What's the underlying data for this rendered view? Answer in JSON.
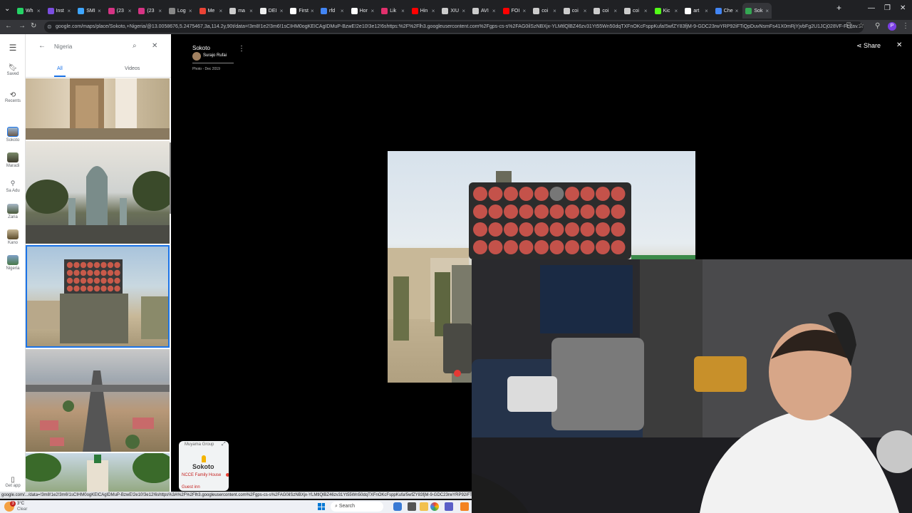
{
  "browser": {
    "tabs": [
      {
        "label": "Wh",
        "color": "#25D366"
      },
      {
        "label": "Inst",
        "color": "#7b4ee0"
      },
      {
        "label": "SMI",
        "color": "#3ea6ff"
      },
      {
        "label": "(23",
        "color": "#d63384"
      },
      {
        "label": "(23",
        "color": "#d63384"
      },
      {
        "label": "Log",
        "color": "#888"
      },
      {
        "label": "Me",
        "color": "#ea4335"
      },
      {
        "label": "ma",
        "color": "#ccc"
      },
      {
        "label": "DEI",
        "color": "#eee"
      },
      {
        "label": "First",
        "color": "#fff"
      },
      {
        "label": "rfd",
        "color": "#4285f4"
      },
      {
        "label": "Hor",
        "color": "#fff"
      },
      {
        "label": "Lik",
        "color": "#e1306c"
      },
      {
        "label": "Hin",
        "color": "#ff0000"
      },
      {
        "label": "XIU",
        "color": "#ccc"
      },
      {
        "label": "AVI",
        "color": "#ccc"
      },
      {
        "label": "FOI",
        "color": "#ff0000"
      },
      {
        "label": "coi",
        "color": "#ccc"
      },
      {
        "label": "coi",
        "color": "#ccc"
      },
      {
        "label": "coi",
        "color": "#ccc"
      },
      {
        "label": "coi",
        "color": "#ccc"
      },
      {
        "label": "Kic",
        "color": "#53fc18"
      },
      {
        "label": "art",
        "color": "#fff"
      },
      {
        "label": "Che",
        "color": "#4285f4"
      },
      {
        "label": "Sok",
        "color": "#34a853"
      }
    ],
    "close_glyph": "×",
    "new_tab": "+",
    "url": "google.com/maps/place/Sokoto,+Nigeria/@13.0058676,5.2475467,3a,114.2y,90t/data=!3m8!1e2!3m6!1sCIHM0ogKEICAgIDMuP-BzwE!2e10!3e12!6shttps:%2F%2Flh3.googleusercontent.com%2Fgps-cs-s%2FAG0ilSzNBXjx-YLMtlQlBZ46zv31Yt55Wn50dqTXFnOKcFsppKufa!5wfZY83fjM-9-GDC23rwYRP92iFTiQpDuvNsmFs41X0mRjYjvbFg2U1JCj028VF-FL2av...",
    "profile_initial": "P"
  },
  "rail": {
    "menu_icon": "menu-icon",
    "saved": "Saved",
    "recents": "Recents",
    "places": [
      "Sokoto",
      "Maradi",
      "Sa Adu",
      "Zaria",
      "Kano",
      "Nigeria"
    ],
    "get_app": "Get app"
  },
  "panel": {
    "search_value": "Nigeria",
    "tab_all": "All",
    "tab_videos": "Videos"
  },
  "viewer": {
    "place": "Sokoto",
    "author": "Surajo Rufai",
    "date": "Photo - Dec 2019",
    "share": "Share",
    "minimap": {
      "label_top": "Muyama Group",
      "city": "Sokoto",
      "poi": "NCCE Family House",
      "poi2": "Guest inn"
    }
  },
  "statusbar": {
    "text": "google.com/.../data=!3m8!1e2!3m6!1sCIHM0ogKEICAgIDMuP-BzwE!2e10!3e12!6shttps%3A%2F%2Flh3.googleusercontent.com%2Fgps-cs-s%2FAG0ilSzNBXjx-YLMtlQlBZ46zv31Yt55Wn50dqTXFnOKcFsppKufa!5wfZY83fjM-9-GDC23rwYRP92iFTiQpDuvNsmFs41X0mRjYjvbFg2U1JCj028VF-FL2av"
  },
  "taskbar": {
    "weather_temp": "3°C",
    "weather_cond": "Clear",
    "search": "Search",
    "notif_count": "3"
  }
}
